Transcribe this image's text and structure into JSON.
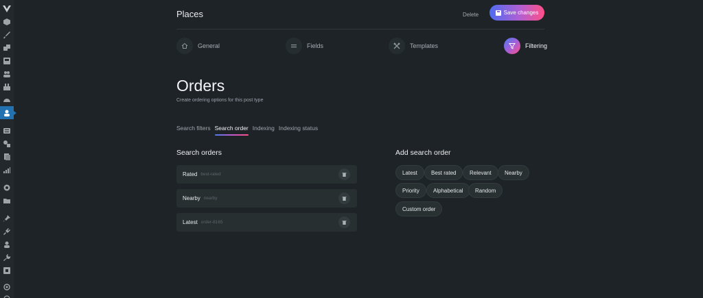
{
  "header": {
    "title": "Places",
    "delete_label": "Delete",
    "save_label": "Save changes"
  },
  "steps": [
    {
      "label": "General",
      "icon": "home-icon",
      "active": false
    },
    {
      "label": "Fields",
      "icon": "equals-icon",
      "active": false
    },
    {
      "label": "Templates",
      "icon": "tools-icon",
      "active": false
    },
    {
      "label": "Filtering",
      "icon": "filter-icon",
      "active": true
    }
  ],
  "page": {
    "title": "Orders",
    "subtitle": "Create ordering options for this post type"
  },
  "tabs": [
    {
      "label": "Search filters",
      "active": false
    },
    {
      "label": "Search order",
      "active": true
    },
    {
      "label": "Indexing",
      "active": false
    },
    {
      "label": "Indexing status",
      "active": false
    }
  ],
  "search_orders": {
    "heading": "Search orders",
    "items": [
      {
        "label": "Rated",
        "key": "best-rated"
      },
      {
        "label": "Nearby",
        "key": "nearby"
      },
      {
        "label": "Latest",
        "key": "order-8165"
      }
    ]
  },
  "add_order": {
    "heading": "Add search order",
    "options": [
      "Latest",
      "Best rated",
      "Relevant",
      "Nearby",
      "Priority",
      "Alphabetical",
      "Random",
      "Custom order"
    ]
  },
  "colors": {
    "background": "#1e2328",
    "sidebar": "#23282d",
    "sidebar_active": "#2271b1",
    "accent_start": "#4d6cf0",
    "accent_end": "#ff4f86"
  }
}
